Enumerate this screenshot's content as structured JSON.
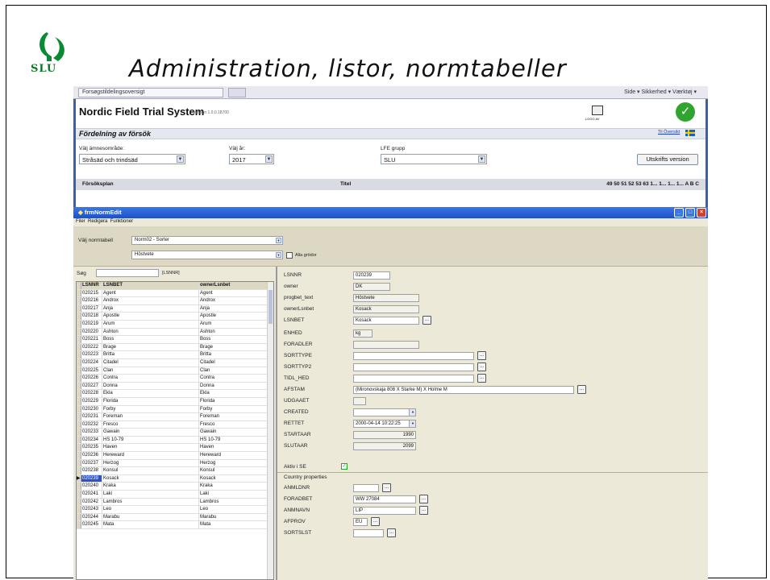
{
  "slide": {
    "title": "Administration, listor, normtabeller",
    "logo_text": "SLU"
  },
  "browser": {
    "tab_title": "Forsøgstildelingsoversigt",
    "toolbar": "Side ▾   Sikkerhed ▾   Værktøj ▾"
  },
  "nfts": {
    "app_title": "Nordic Field Trial System",
    "version": "version 1.0.0.18700",
    "subtitle": "Fördelning av försök",
    "logout_label": "LOGG AV",
    "overview_link": "Til Översikt",
    "area_label": "Välj ämnesområde:",
    "area_value": "Stråsäd och trindsäd",
    "year_label": "Välj år:",
    "year_value": "2017",
    "group_label": "LFE grupp",
    "group_value": "SLU",
    "print_button": "Utskrifts version",
    "col_plan": "Försöksplan",
    "col_title": "Titel",
    "col_nums": "49  50  51  52  53  63  1...  1...  1...  1...  A  B  C"
  },
  "form": {
    "window_title": "frmNormEdit",
    "menu": [
      "Filer",
      "Redigera",
      "Funktioner"
    ],
    "choose_table_label": "Välj normtabell",
    "table_value": "Norm02 - Sorter",
    "crop_value": "Höstvete",
    "all_crops_label": "Alla grödor",
    "search_label": "Søg",
    "search_hint": "[LSNNR]",
    "grid_headers": [
      "LSNNR",
      "LSNBET",
      "ownerLsnbet"
    ],
    "rows": [
      [
        "020215",
        "Agent",
        "Agent"
      ],
      [
        "020216",
        "Androx",
        "Androx"
      ],
      [
        "020217",
        "Anja",
        "Anja"
      ],
      [
        "020218",
        "Apostle",
        "Apostle"
      ],
      [
        "020219",
        "Arum",
        "Arum"
      ],
      [
        "020220",
        "Ashton",
        "Ashton"
      ],
      [
        "020221",
        "Boss",
        "Boss"
      ],
      [
        "020222",
        "Brage",
        "Brage"
      ],
      [
        "020223",
        "Britta",
        "Britta"
      ],
      [
        "020224",
        "Citadel",
        "Citadel"
      ],
      [
        "020225",
        "Clan",
        "Clan"
      ],
      [
        "020226",
        "Contra",
        "Contra"
      ],
      [
        "020227",
        "Donna",
        "Donna"
      ],
      [
        "020228",
        "Ekla",
        "Ekla"
      ],
      [
        "020229",
        "Florida",
        "Florida"
      ],
      [
        "020230",
        "Forby",
        "Forby"
      ],
      [
        "020231",
        "Foreman",
        "Foreman"
      ],
      [
        "020232",
        "Fresco",
        "Fresco"
      ],
      [
        "020233",
        "Gawain",
        "Gawain"
      ],
      [
        "020234",
        "HS 10-79",
        "HS 10-79"
      ],
      [
        "020235",
        "Haven",
        "Haven"
      ],
      [
        "020236",
        "Hereward",
        "Hereward"
      ],
      [
        "020237",
        "Herzog",
        "Herzog"
      ],
      [
        "020238",
        "Konsul",
        "Konsul"
      ],
      [
        "020239",
        "Kosack",
        "Kosack"
      ],
      [
        "020240",
        "Kraka",
        "Kraka"
      ],
      [
        "020241",
        "Laki",
        "Laki"
      ],
      [
        "020242",
        "Lambros",
        "Lambros"
      ],
      [
        "020243",
        "Leo",
        "Leo"
      ],
      [
        "020244",
        "Marabu",
        "Marabu"
      ],
      [
        "020245",
        "Mata",
        "Mata"
      ]
    ],
    "fields": {
      "LSNNR": "020239",
      "owner": "DK",
      "progbet_text": "Höstvete",
      "ownerLsnbet": "Kosack",
      "LSNBET": "Kosack",
      "ENHED": "kg",
      "FORADLER": "",
      "SORTTYPE": "",
      "SORTTYP2": "",
      "TIDL_HED": "",
      "AFSTAM": "(Mironovskaja 808 X Starke M) X Holme M",
      "UDGAAET": "",
      "CREATED": "",
      "RETTET": "2000-04-14 10:22:25",
      "STARTAAR": "1990",
      "SLUTAAR": "2099"
    },
    "field_labels": [
      "LSNNR",
      "owner",
      "progbet_text",
      "ownerLsnbet",
      "LSNBET",
      "ENHED",
      "FORADLER",
      "SORTTYPE",
      "SORTTYP2",
      "TIDL_HED",
      "AFSTAM",
      "UDGAAET",
      "CREATED",
      "RETTET",
      "STARTAAR",
      "SLUTAAR"
    ],
    "aktiv_label": "Aktiv i SE",
    "country_props_label": "Country properties",
    "country_fields": {
      "ANMLDNR": "",
      "FORADBET": "WW 27084",
      "ANMNAVN": "LIP",
      "AFPROV": "EU",
      "SORTSLST": ""
    }
  }
}
